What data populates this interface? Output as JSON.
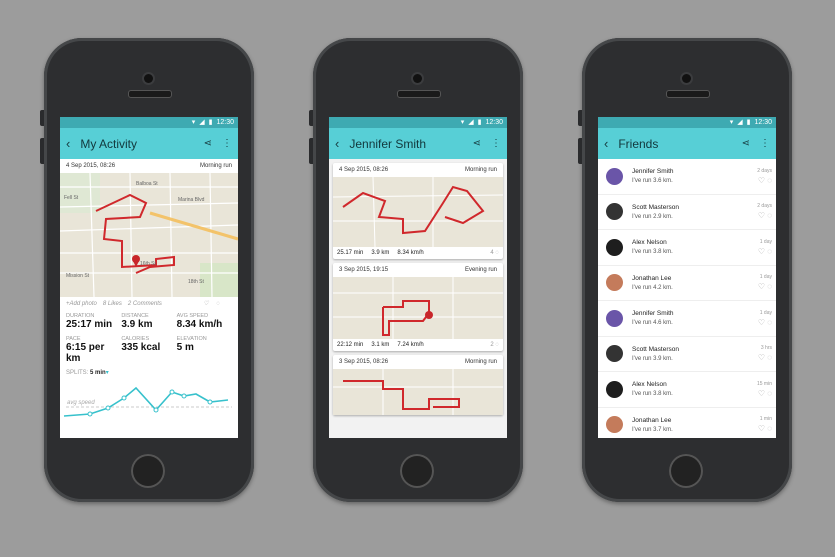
{
  "status": {
    "time": "12:30"
  },
  "colors": {
    "accent": "#57cfd6",
    "route": "#d0282c",
    "chart": "#37c1cc"
  },
  "screen1": {
    "title": "My Activity",
    "date": "4 Sep 2015, 08:26",
    "run_type": "Morning run",
    "map_labels": [
      "Balboa St",
      "Fell St",
      "Oak St",
      "Marina Blvd",
      "Mission St",
      "16th St",
      "18th St",
      "Mission Dolores Park",
      "Tartine Bakery & Cafe"
    ],
    "add_photo": "+Add photo",
    "likes": "8 Likes",
    "comments": "2 Comments",
    "stats": [
      {
        "label": "DURATION",
        "value": "25:17 min"
      },
      {
        "label": "DISTANCE",
        "value": "3.9 km"
      },
      {
        "label": "AVG SPEED",
        "value": "8.34 km/h"
      },
      {
        "label": "PACE",
        "value": "6:15 per km"
      },
      {
        "label": "CALORIES",
        "value": "335 kcal"
      },
      {
        "label": "ELEVATION",
        "value": "5 m"
      }
    ],
    "splits_label": "SPLITS:",
    "splits_value": "5 min",
    "avg_label": "avg speed"
  },
  "screen2": {
    "title": "Jennifer Smith",
    "cards": [
      {
        "date": "4 Sep 2015, 08:26",
        "run_type": "Morning run",
        "duration": "25.17 min",
        "distance": "3.9 km",
        "speed": "8.34 km/h",
        "comments": "4"
      },
      {
        "date": "3 Sep 2015, 19:15",
        "run_type": "Evening run",
        "duration": "22:12 min",
        "distance": "3.1 km",
        "speed": "7.24 km/h",
        "comments": "2"
      },
      {
        "date": "3 Sep 2015, 08:26",
        "run_type": "Morning run"
      }
    ]
  },
  "screen3": {
    "title": "Friends",
    "friends": [
      {
        "name": "Jennifer Smith",
        "sub": "I've run 3.6 km.",
        "time": "2 days",
        "avatar": "#6a55a8"
      },
      {
        "name": "Scott Masterson",
        "sub": "I've run 2.9 km.",
        "time": "2 days",
        "avatar": "#333333"
      },
      {
        "name": "Alex Nelson",
        "sub": "I've run 3.8 km.",
        "time": "1 day",
        "avatar": "#1e1e1e"
      },
      {
        "name": "Jonathan Lee",
        "sub": "I've run 4.2 km.",
        "time": "1 day",
        "avatar": "#c47b5b"
      },
      {
        "name": "Jennifer Smith",
        "sub": "I've run 4.6 km.",
        "time": "1 day",
        "avatar": "#6a55a8"
      },
      {
        "name": "Scott Masterson",
        "sub": "I've run 3.9 km.",
        "time": "3 hrs",
        "avatar": "#333333"
      },
      {
        "name": "Alex Nelson",
        "sub": "I've run 3.8 km.",
        "time": "15 min",
        "avatar": "#1e1e1e"
      },
      {
        "name": "Jonathan Lee",
        "sub": "I've run 3.7 km.",
        "time": "1 min",
        "avatar": "#c47b5b"
      }
    ]
  }
}
